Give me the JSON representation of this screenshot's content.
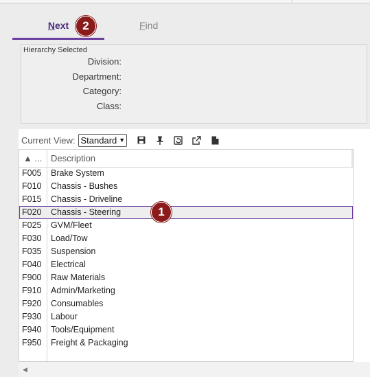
{
  "tabs": {
    "next_label": "Next",
    "next_access": "N",
    "next_rest": "ext",
    "find_label": "Find",
    "find_access": "F",
    "find_rest": "ind"
  },
  "badges": {
    "b1": "1",
    "b2": "2"
  },
  "hierarchy": {
    "title": "Hierarchy Selected",
    "division_label": "Division:",
    "department_label": "Department:",
    "category_label": "Category:",
    "class_label": "Class:"
  },
  "grid": {
    "view_label": "Current View:",
    "view_value": "Standard",
    "col_code": "▲ ...",
    "col_desc": "Description",
    "selected_code": "F020",
    "rows": [
      {
        "code": "F005",
        "desc": "Brake System"
      },
      {
        "code": "F010",
        "desc": "Chassis - Bushes"
      },
      {
        "code": "F015",
        "desc": "Chassis - Driveline"
      },
      {
        "code": "F020",
        "desc": "Chassis - Steering"
      },
      {
        "code": "F025",
        "desc": "GVM/Fleet"
      },
      {
        "code": "F030",
        "desc": "Load/Tow"
      },
      {
        "code": "F035",
        "desc": "Suspension"
      },
      {
        "code": "F040",
        "desc": "Electrical"
      },
      {
        "code": "F900",
        "desc": "Raw Materials"
      },
      {
        "code": "F910",
        "desc": "Admin/Marketing"
      },
      {
        "code": "F920",
        "desc": "Consumables"
      },
      {
        "code": "F930",
        "desc": "Labour"
      },
      {
        "code": "F940",
        "desc": "Tools/Equipment"
      },
      {
        "code": "F950",
        "desc": "Freight & Packaging"
      }
    ]
  },
  "icons": [
    "save-icon",
    "pin-icon",
    "restore-view-icon",
    "export-icon",
    "document-icon",
    "sort-asc-icon",
    "scroll-left-icon"
  ],
  "colors": {
    "accent": "#6b3fa0",
    "badge": "#8b1a1a"
  }
}
